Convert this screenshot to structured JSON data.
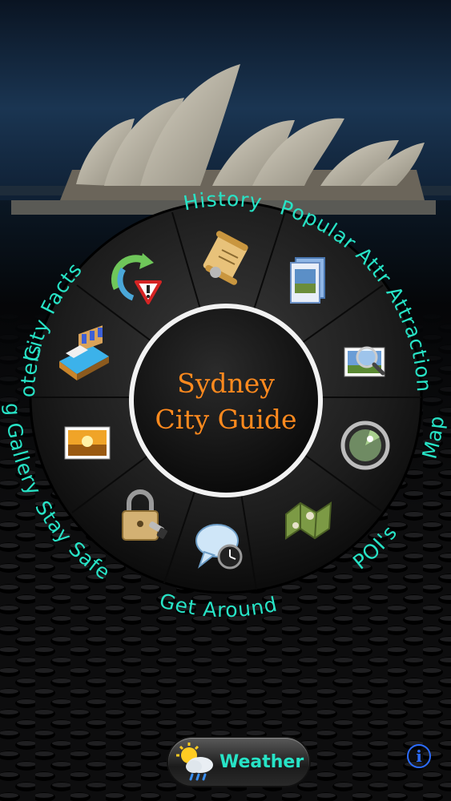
{
  "app": {
    "title_line1": "Sydney",
    "title_line2": "City Guide"
  },
  "menu": {
    "history": "History",
    "popular_attr": "Popular Attr Attractions",
    "map": "Map",
    "pois": "POI's",
    "get_around": "Get Around",
    "stay_safe": "Stay Safe",
    "img_gallery": "Img Gallery",
    "hotels": "Hotels",
    "city_facts": "City Facts"
  },
  "bottom": {
    "weather_label": "Weather",
    "info_glyph": "i"
  },
  "colors": {
    "label": "#27e3c6",
    "title": "#ff8a1e",
    "info": "#2c6cff"
  }
}
